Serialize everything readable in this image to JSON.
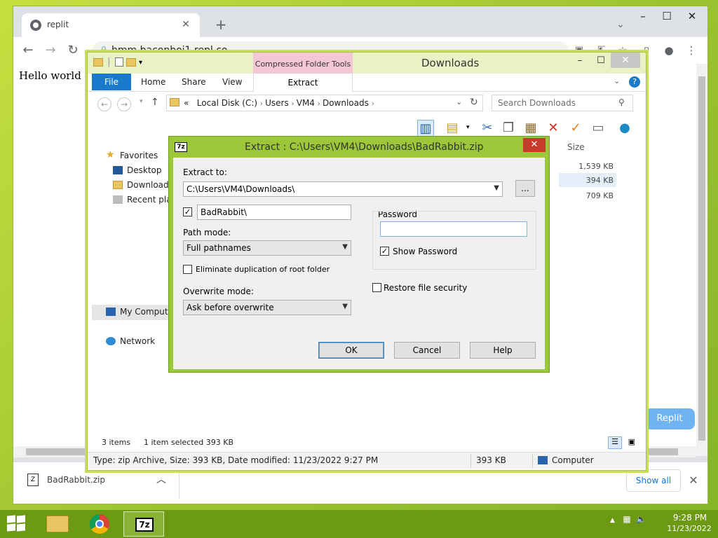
{
  "browser": {
    "tab_title": "replit",
    "url": "hmm.baconboi1.repl.co",
    "page_text": "Hello world",
    "replit_button": "Replit"
  },
  "downloads_bar": {
    "file_name": "BadRabbit.zip",
    "show_all": "Show all"
  },
  "explorer": {
    "title": "Downloads",
    "context_tab_group": "Compressed Folder Tools",
    "ribbon_tabs": [
      "File",
      "Home",
      "Share",
      "View"
    ],
    "context_tab": "Extract",
    "breadcrumb": {
      "prefix": "«",
      "parts": [
        "Local Disk (C:)",
        "Users",
        "VM4",
        "Downloads"
      ]
    },
    "search_placeholder": "Search Downloads",
    "nav": {
      "favorites": "Favorites",
      "desktop": "Desktop",
      "downloads": "Downloads",
      "recent": "Recent plac",
      "my_computer": "My Compute",
      "network": "Network"
    },
    "size_column": {
      "header": "Size",
      "values": [
        "1,539 KB",
        "394 KB",
        "709 KB"
      ]
    },
    "status": {
      "items": "3 items",
      "selected": "1 item selected  393 KB"
    },
    "details": {
      "text": "Type: zip Archive, Size: 393 KB, Date modified: 11/23/2022 9:27 PM",
      "size": "393 KB",
      "location": "Computer"
    }
  },
  "extract_dialog": {
    "title": "Extract : C:\\Users\\VM4\\Downloads\\BadRabbit.zip",
    "logo": "7z",
    "extract_to_label": "Extract to:",
    "extract_to_value": "C:\\Users\\VM4\\Downloads\\",
    "browse_label": "...",
    "subfolder_value": "BadRabbit\\",
    "subfolder_checked": true,
    "path_mode_label": "Path mode:",
    "path_mode_value": "Full pathnames",
    "eliminate_label": "Eliminate duplication of root folder",
    "eliminate_checked": false,
    "overwrite_label": "Overwrite mode:",
    "overwrite_value": "Ask before overwrite",
    "password_label": "Password",
    "password_value": "",
    "show_password_label": "Show Password",
    "show_password_checked": true,
    "restore_security_label": "Restore file security",
    "restore_security_checked": false,
    "ok_label": "OK",
    "cancel_label": "Cancel",
    "help_label": "Help"
  },
  "taskbar": {
    "time": "9:28 PM",
    "date": "11/23/2022",
    "app_7z_logo": "7z"
  }
}
